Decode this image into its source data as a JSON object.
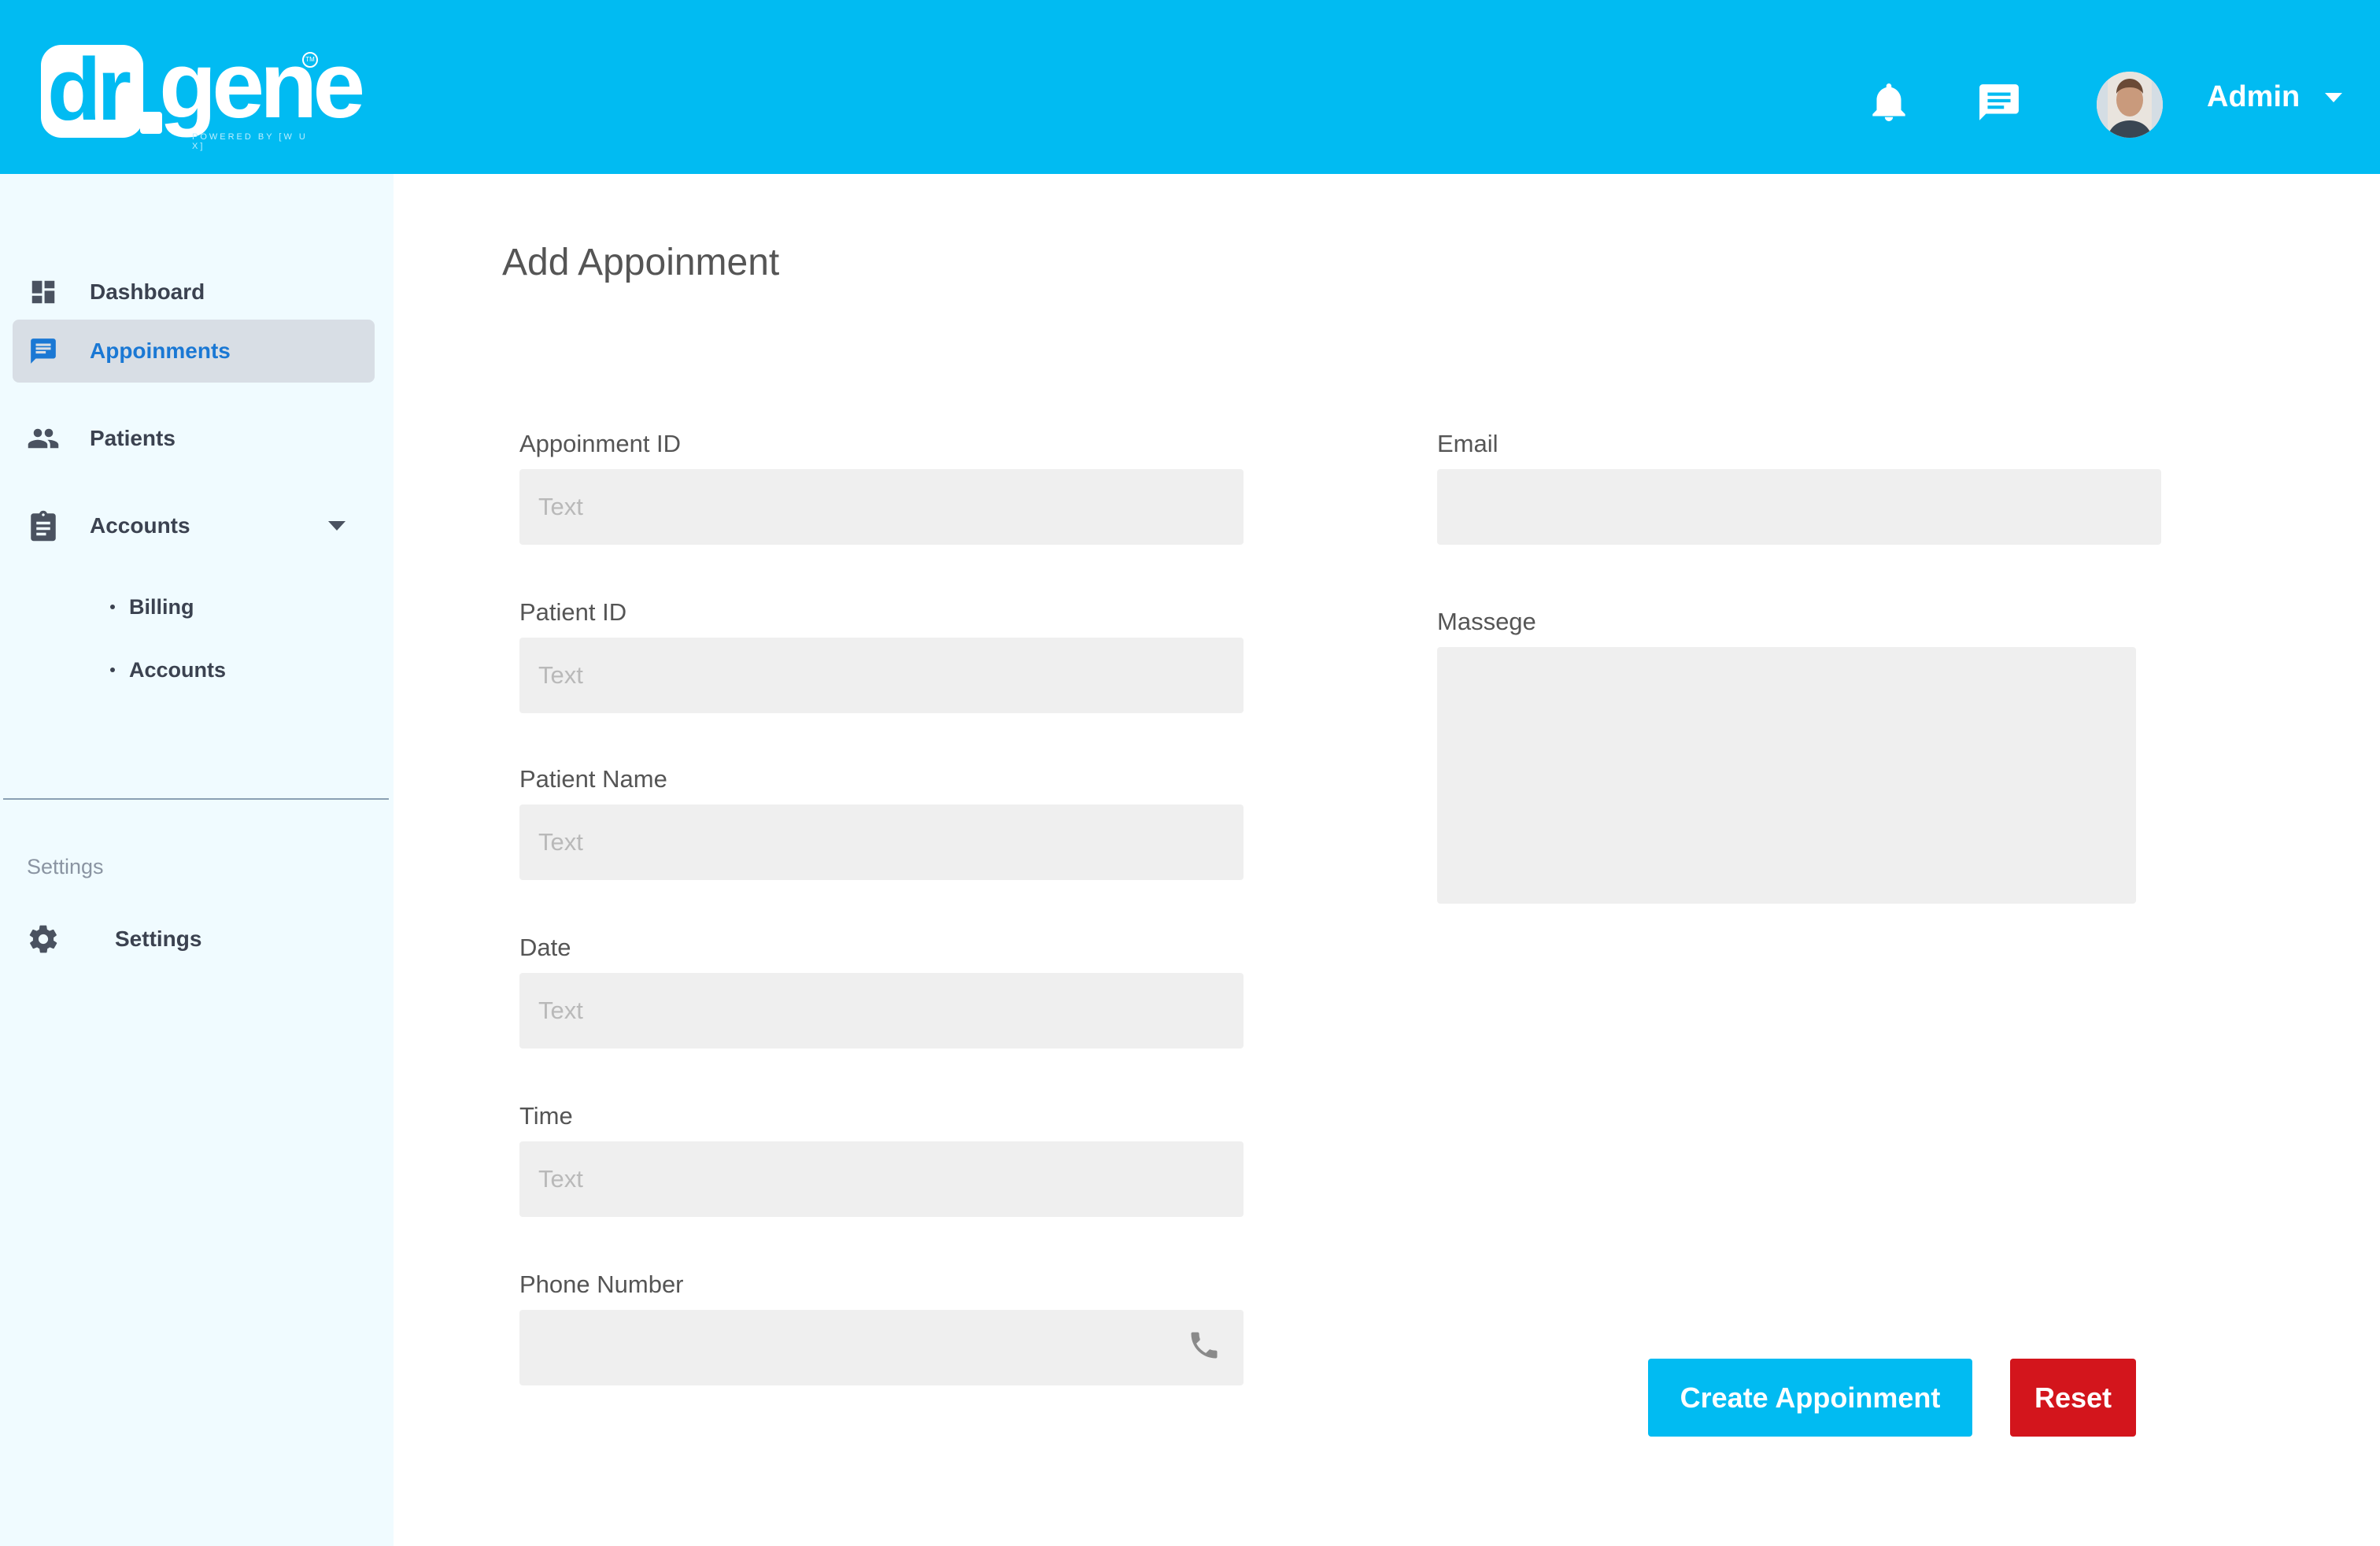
{
  "header": {
    "logo": {
      "dr": "dr",
      "gene": "gene",
      "powered": "POWERED BY [W U X]"
    },
    "icons": [
      "bell-icon",
      "chat-icon"
    ],
    "user_name": "Admin"
  },
  "sidebar": {
    "items": [
      {
        "label": "Dashboard",
        "icon": "dashboard-icon"
      },
      {
        "label": "Appoinments",
        "icon": "message-icon",
        "active": true
      },
      {
        "label": "Patients",
        "icon": "people-icon"
      },
      {
        "label": "Accounts",
        "icon": "clipboard-icon"
      }
    ],
    "subitems": [
      {
        "label": "Billing"
      },
      {
        "label": "Accounts"
      }
    ],
    "section_title": "Settings",
    "settings_label": "Settings"
  },
  "main": {
    "title": "Add Appoinment",
    "fields": {
      "appointment_id": {
        "label": "Appoinment ID",
        "placeholder": "Text",
        "value": ""
      },
      "patient_id": {
        "label": "Patient ID",
        "placeholder": "Text",
        "value": ""
      },
      "patient_name": {
        "label": "Patient Name",
        "placeholder": "Text",
        "value": ""
      },
      "date": {
        "label": "Date",
        "placeholder": "Text",
        "value": ""
      },
      "time": {
        "label": "Time",
        "placeholder": "Text",
        "value": ""
      },
      "phone": {
        "label": "Phone Number",
        "placeholder": "",
        "value": ""
      },
      "email": {
        "label": "Email",
        "placeholder": "",
        "value": ""
      },
      "message": {
        "label": "Massege",
        "placeholder": "",
        "value": ""
      }
    },
    "buttons": {
      "create": "Create Appoinment",
      "reset": "Reset"
    }
  },
  "colors": {
    "primary": "#01bbf2",
    "danger": "#d3151c",
    "sidebar_bg": "#f0fbff",
    "active_item_bg": "#d8dee5",
    "input_bg": "#efefef"
  }
}
